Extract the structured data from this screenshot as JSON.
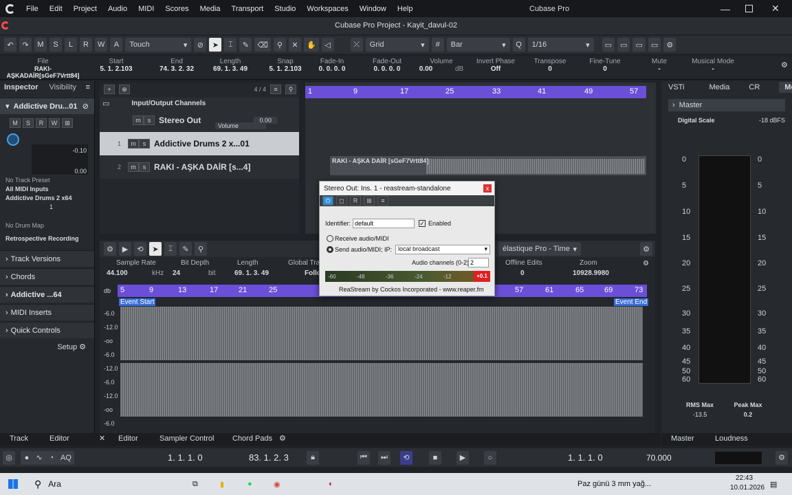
{
  "menubar": {
    "app_icon": "cubase-logo",
    "items": [
      "File",
      "Edit",
      "Project",
      "Audio",
      "MIDI",
      "Scores",
      "Media",
      "Transport",
      "Studio",
      "Workspaces",
      "Window",
      "Help"
    ],
    "title": "Cubase Pro"
  },
  "window": {
    "title": "Cubase Pro Project - Kayit_davul-02"
  },
  "toolbar": {
    "buttons": [
      "M",
      "S",
      "L",
      "R",
      "W",
      "A"
    ],
    "automation_mode": "Touch",
    "grid_type": "Grid",
    "grid_mode": "Bar",
    "quantize": "1/16"
  },
  "infoline": {
    "name_label": "File",
    "name_value": "RAKI-AŞKADAİR[sGeF7Vrtt84]",
    "cols": [
      {
        "h": "Start",
        "v": "5. 1. 2.103"
      },
      {
        "h": "End",
        "v": "74. 3. 2. 32"
      },
      {
        "h": "Length",
        "v": "69. 1. 3. 49"
      },
      {
        "h": "Snap",
        "v": "5. 1. 2.103"
      },
      {
        "h": "Fade-In",
        "v": "0. 0. 0. 0"
      },
      {
        "h": "Fade-Out",
        "v": "0. 0. 0. 0"
      },
      {
        "h": "Volume",
        "v": "0.00"
      },
      {
        "h": "Invert Phase",
        "v": "Off"
      },
      {
        "h": "Transpose",
        "v": "0"
      },
      {
        "h": "Fine-Tune",
        "v": "0"
      },
      {
        "h": "Mute",
        "v": "-"
      },
      {
        "h": "Musical Mode",
        "v": "-"
      }
    ],
    "volume_unit": "dB"
  },
  "inspector": {
    "tabs": [
      "Inspector",
      "Visibility"
    ],
    "track_name": "Addictive Dru...01",
    "values": [
      "-0.10",
      "0.00"
    ],
    "preset": "No Track Preset",
    "midi_in": "All MIDI Inputs",
    "instrument": "Addictive Drums 2 x64",
    "channel": "1",
    "drum_map": "No Drum Map",
    "retro": "Retrospective Recording",
    "sections": [
      "Track Versions",
      "Chords",
      "Addictive ...64",
      "MIDI Inserts",
      "Quick Controls"
    ],
    "setup": "Setup",
    "bottom_tabs": [
      "Track",
      "Editor"
    ]
  },
  "tracklist": {
    "count": "4 / 4",
    "folder": "Input/Output Channels",
    "stereo_out": "Stereo Out",
    "stereo_val": "0.00",
    "volume_label": "Volume",
    "tracks": [
      {
        "num": "1",
        "name": "Addictive Drums 2 x...01"
      },
      {
        "num": "2",
        "name": "RAKI - AŞKA DAİR [s...4]"
      }
    ]
  },
  "ruler": {
    "marks": [
      "1",
      "9",
      "17",
      "25",
      "33",
      "41",
      "49",
      "57"
    ]
  },
  "clip": {
    "name": "RAKI - AŞKA DAİR [sGeF7Vrtt84]"
  },
  "dialog": {
    "title": "Stereo Out: Ins. 1 - reastream-standalone",
    "close": "x",
    "identifier_label": "Identifier:",
    "identifier_value": "default",
    "enabled_label": "Enabled",
    "receive_label": "Receive audio/MIDI",
    "send_label": "Send audio/MIDI; IP:",
    "ip_value": "local broadcast",
    "channels_label": "Audio channels (0-2):",
    "channels_value": "2",
    "meter_marks": [
      "-60",
      "-48",
      "-36",
      "-24",
      "-12"
    ],
    "meter_peak": "+0.1",
    "footer": "ReaStream by Cockos Incorporated - www.reaper.fm"
  },
  "lower": {
    "info_headers": [
      "Sample Rate",
      "Bit Depth",
      "Length",
      "Global Tra",
      "Offline Edits",
      "Zoom"
    ],
    "info_values": [
      "44.100",
      "kHz",
      "24",
      "bit",
      "69. 1. 3. 49",
      "Follow",
      "0",
      "10928.9980"
    ],
    "algo": "élastique Pro - Time",
    "ruler": [
      "5",
      "9",
      "13",
      "17",
      "21",
      "25",
      "57",
      "61",
      "65",
      "69",
      "73"
    ],
    "event_start": "Event Start",
    "event_end": "Event End",
    "db_scale": [
      "-6.0",
      "-12.0",
      "-oo",
      "-6.0",
      "-12.0",
      "-6.0",
      "-12.0",
      "-oo",
      "-6.0",
      "-12.0"
    ],
    "db_unit": "db",
    "tabs": [
      "Editor",
      "Sampler Control",
      "Chord Pads"
    ]
  },
  "meter": {
    "tabs": [
      "VSTi",
      "Media",
      "CR",
      "Meter"
    ],
    "master": "Master",
    "scale_label": "Digital Scale",
    "scale_value": "-18 dBFS",
    "ticks": [
      "0",
      "5",
      "10",
      "15",
      "20",
      "25",
      "30",
      "35",
      "40",
      "45",
      "50",
      "60"
    ],
    "rms_label": "RMS Max",
    "rms_value": "-13.5",
    "peak_label": "Peak Max",
    "peak_value": "0.2",
    "bottom_tabs": [
      "Master",
      "Loudness"
    ]
  },
  "transport": {
    "left_locator": "1. 1. 1. 0",
    "right_locator": "83. 1. 2. 3",
    "position": "1. 1. 1. 0",
    "tempo": "70.000"
  },
  "taskbar": {
    "search": "Ara",
    "weather": "Paz günü 3 mm yağ...",
    "time": "22:43",
    "date": "10.01.2026"
  },
  "colors": {
    "ruler": "#6b4fd8",
    "accent": "#2f8fd8",
    "dialog_bg": "#e9e9ea",
    "peak": "#e02020"
  }
}
